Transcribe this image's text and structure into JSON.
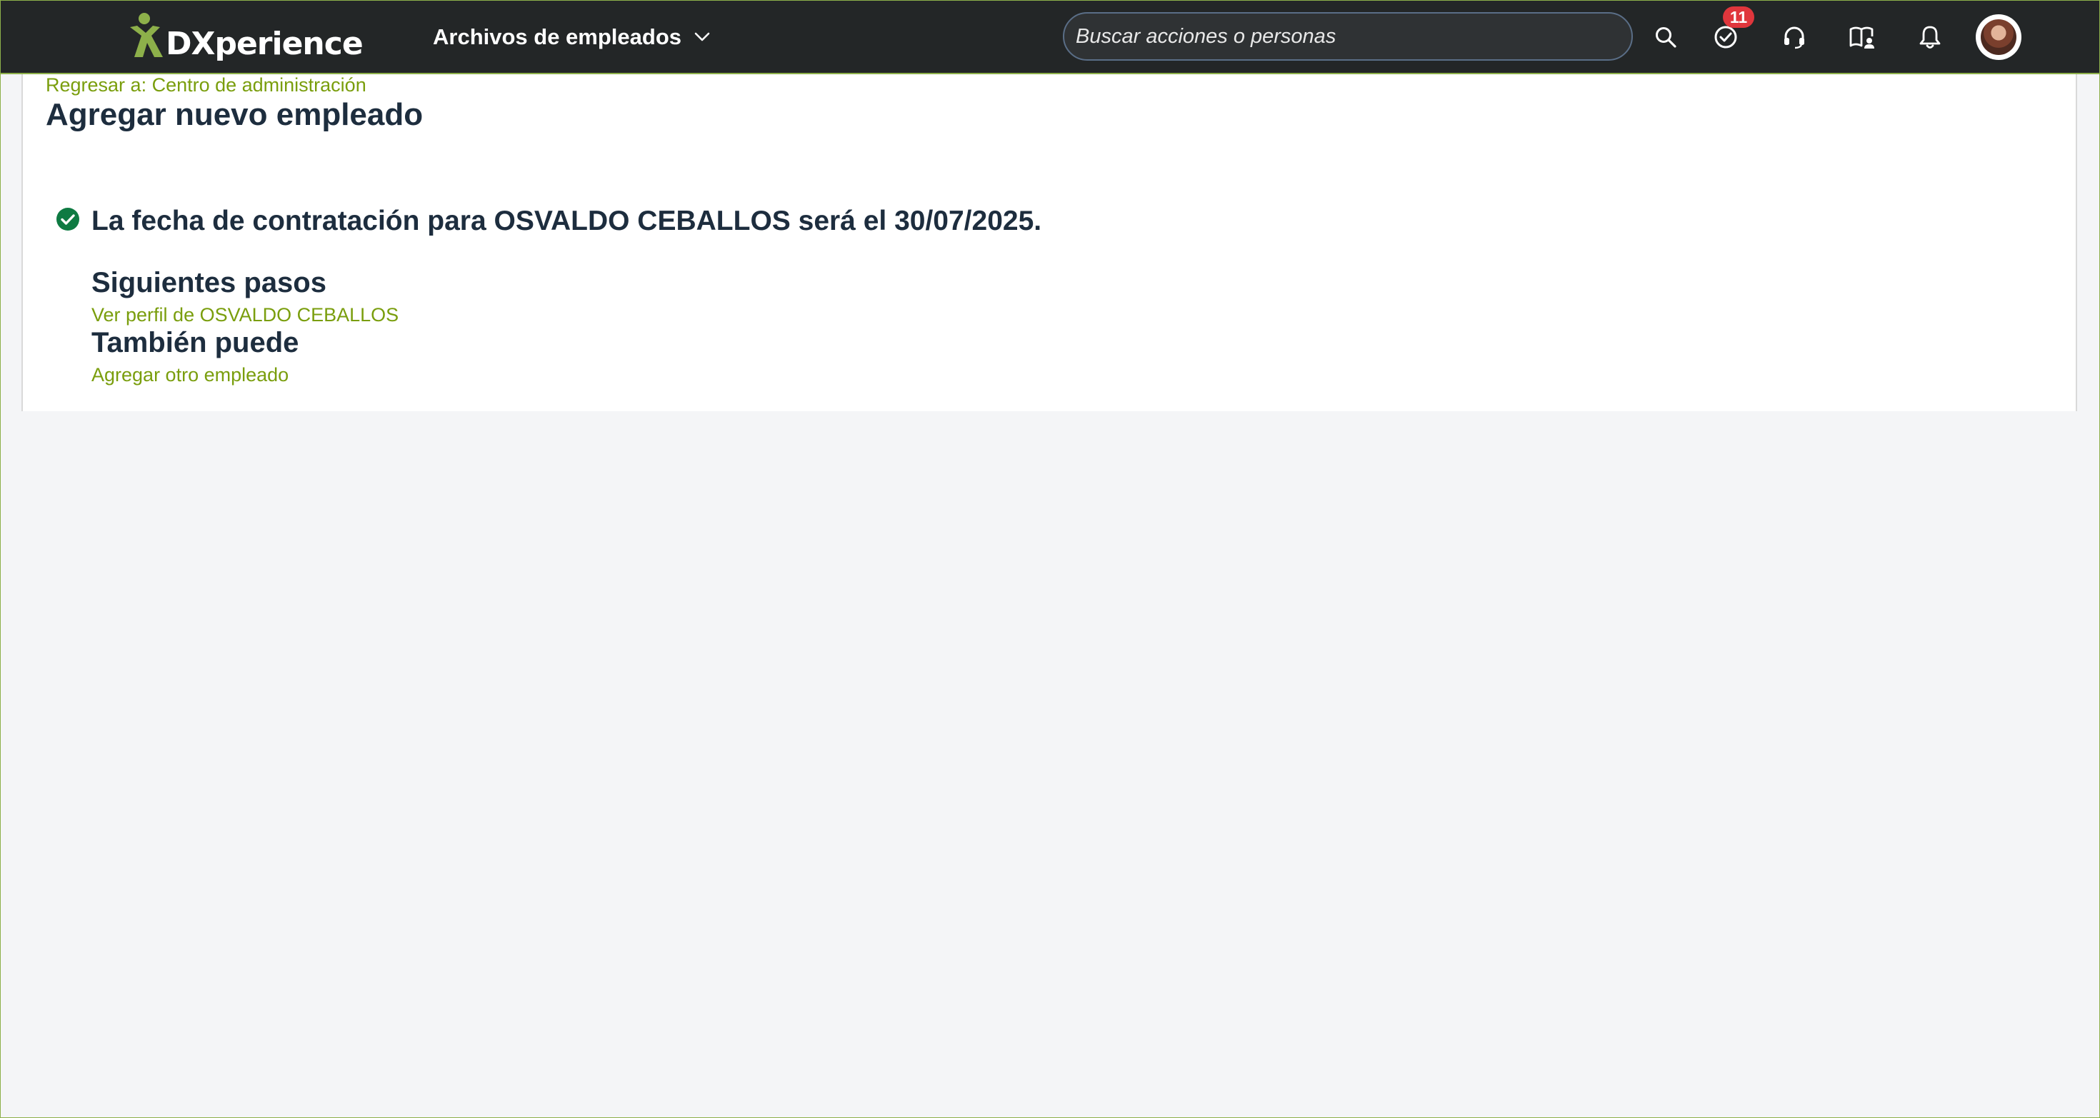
{
  "header": {
    "logo_text": "DXperience",
    "module_label": "Archivos de empleados",
    "search_placeholder": "Buscar acciones o personas",
    "todo_badge_count": "11"
  },
  "icons": {
    "search": "search-icon",
    "todo": "check-circle-icon",
    "support": "headset-icon",
    "learning": "book-user-icon",
    "notifications": "bell-icon",
    "module_menu": "chevron-down-icon",
    "success": "check-circle-filled-icon"
  },
  "breadcrumb": {
    "back_label": "Regresar a: Centro de administración"
  },
  "page": {
    "title": "Agregar nuevo empleado",
    "success_message": "La fecha de contratación para OSVALDO CEBALLOS será el 30/07/2025.",
    "next_steps_heading": "Siguientes pasos",
    "view_profile_link": "Ver perfil de OSVALDO CEBALLOS",
    "also_heading": "También puede",
    "add_another_link": "Agregar otro empleado"
  },
  "colors": {
    "shell_bg": "#232627",
    "accent_green": "#8db04a",
    "link_green": "#7a9e0d",
    "success_green": "#0e7a42",
    "badge_red": "#e0363c",
    "title_text": "#1d2d3e",
    "page_bg": "#f4f5f7"
  }
}
